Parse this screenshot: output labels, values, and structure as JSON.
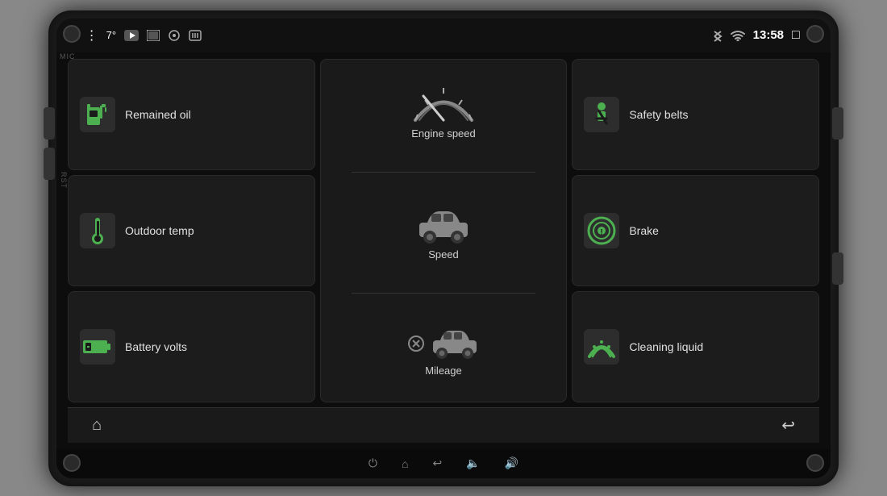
{
  "device": {
    "mic_label": "MIC",
    "rst_label": "RST"
  },
  "status_bar": {
    "temperature": "7°",
    "time": "13:58",
    "icons": [
      "circle",
      "dots",
      "youtube",
      "camera1",
      "camera2",
      "camera3",
      "bluetooth",
      "wifi",
      "square",
      "back-arrow"
    ]
  },
  "widgets": {
    "remained_oil": {
      "label": "Remained oil",
      "icon": "fuel"
    },
    "outdoor_temp": {
      "label": "Outdoor temp",
      "icon": "thermometer"
    },
    "battery_volts": {
      "label": "Battery volts",
      "icon": "battery"
    },
    "engine_speed": {
      "label": "Engine speed",
      "icon": "gauge"
    },
    "speed": {
      "label": "Speed",
      "icon": "car"
    },
    "mileage": {
      "label": "Mileage",
      "icon": "car-warning"
    },
    "safety_belts": {
      "label": "Safety belts",
      "icon": "seatbelt"
    },
    "brake": {
      "label": "Brake",
      "icon": "brake"
    },
    "cleaning_liquid": {
      "label": "Cleaning liquid",
      "icon": "wiper"
    }
  },
  "nav_bar": {
    "home_label": "⌂",
    "back_label": "↩"
  },
  "sys_bar": {
    "icons": [
      "power",
      "home",
      "back",
      "vol-down",
      "vol-up"
    ]
  }
}
